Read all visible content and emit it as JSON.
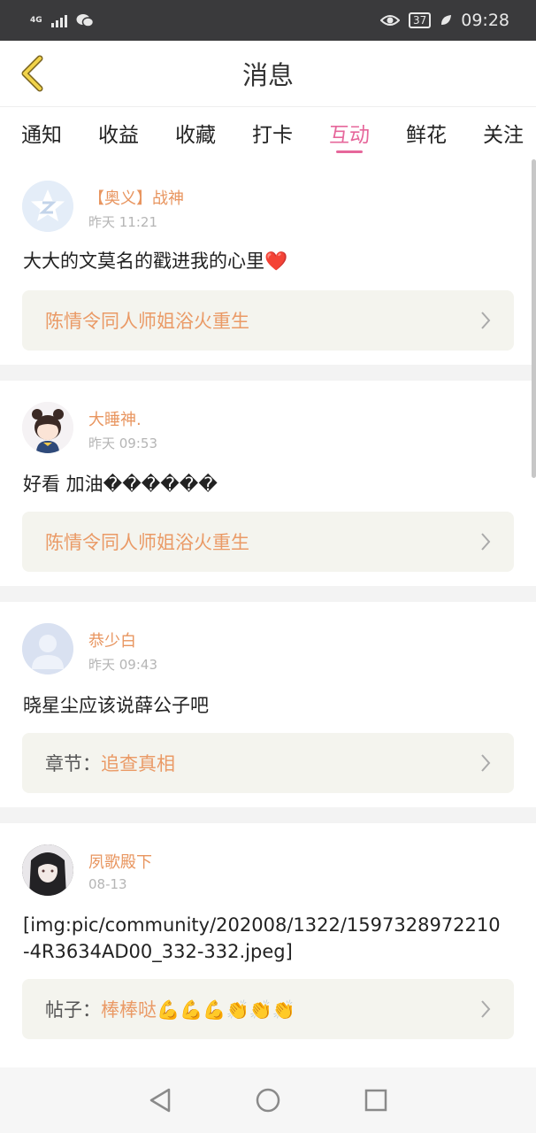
{
  "status_bar": {
    "network": "4G",
    "battery": "37",
    "time": "09:28",
    "icons": [
      "signal-icon",
      "wechat-icon",
      "eye-icon",
      "battery-icon",
      "leaf-icon"
    ]
  },
  "header": {
    "title": "消息"
  },
  "tabs": [
    {
      "label": "通知",
      "active": false
    },
    {
      "label": "收益",
      "active": false
    },
    {
      "label": "收藏",
      "active": false
    },
    {
      "label": "打卡",
      "active": false
    },
    {
      "label": "互动",
      "active": true
    },
    {
      "label": "鲜花",
      "active": false
    },
    {
      "label": "关注",
      "active": false
    }
  ],
  "messages": [
    {
      "author": "【奥义】战神",
      "time": "昨天 11:21",
      "comment": "大大的文莫名的戳进我的心里❤️",
      "ref_label": "",
      "ref_text": "陈情令同人师姐浴火重生"
    },
    {
      "author": "大睡神.",
      "time": "昨天 09:53",
      "comment": "好看 加油������",
      "ref_label": "",
      "ref_text": "陈情令同人师姐浴火重生"
    },
    {
      "author": "恭少白",
      "time": "昨天 09:43",
      "comment": "晓星尘应该说薛公子吧",
      "ref_label": "章节：",
      "ref_text": "追查真相"
    },
    {
      "author": "夙歌殿下",
      "time": "08-13",
      "comment_line1": "[img:pic/community/202008/1322/1597328972210",
      "comment_line2": "-4R3634AD00_332-332.jpeg]",
      "ref_label": "帖子：",
      "ref_text": "棒棒哒💪💪💪👏👏👏"
    }
  ],
  "colors": {
    "accent_pink": "#e6679b",
    "author_orange": "#e8955f",
    "ref_text_orange": "#ea9a66",
    "ref_bg": "#f4f4ee",
    "status_bg": "#3a3a3c"
  }
}
